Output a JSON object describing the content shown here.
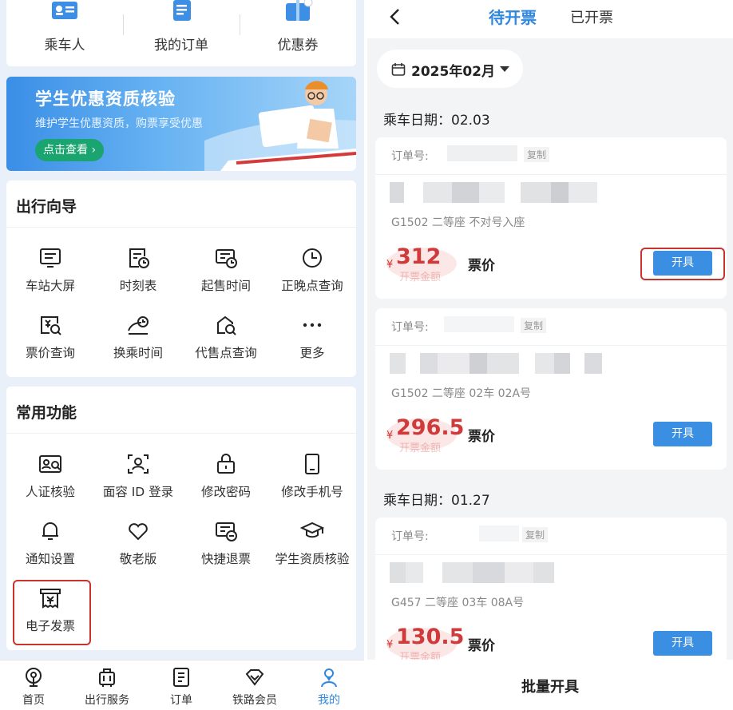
{
  "left": {
    "top_row": [
      "乘车人",
      "我的订单",
      "优惠券"
    ],
    "banner": {
      "title": "学生优惠资质核验",
      "subtitle": "维护学生优惠资质，购票享受优惠",
      "button": "点击查看 ›"
    },
    "travel_guide": {
      "title": "出行向导",
      "items": [
        "车站大屏",
        "时刻表",
        "起售时间",
        "正晚点查询",
        "票价查询",
        "换乘时间",
        "代售点查询",
        "更多"
      ]
    },
    "common": {
      "title": "常用功能",
      "items": [
        "人证核验",
        "面容 ID 登录",
        "修改密码",
        "修改手机号",
        "通知设置",
        "敬老版",
        "快捷退票",
        "学生资质核验",
        "电子发票"
      ]
    },
    "tabbar": [
      "首页",
      "出行服务",
      "订单",
      "铁路会员",
      "我的"
    ],
    "active_tab": "我的"
  },
  "right": {
    "tabs": {
      "active": "待开票",
      "other": "已开票"
    },
    "month": "2025年02月",
    "groups": [
      {
        "date_label": "乘车日期：02.03",
        "orders": [
          {
            "order_label": "订单号:",
            "copy": "复制",
            "train": "G1502 二等座  不对号入座",
            "currency": "¥",
            "price": "312",
            "watermark": "开票金额",
            "price_label": "票价",
            "button": "开具"
          },
          {
            "order_label": "订单号:",
            "copy": "复制",
            "train": "G1502 二等座 02车 02A号",
            "currency": "¥",
            "price": "296.5",
            "watermark": "开票金额",
            "price_label": "票价",
            "button": "开具"
          }
        ]
      },
      {
        "date_label": "乘车日期：01.27",
        "orders": [
          {
            "order_label": "订单号:",
            "copy": "复制",
            "train": "G457 二等座 03车 08A号",
            "currency": "¥",
            "price": "130.5",
            "watermark": "开票金额",
            "price_label": "票价",
            "button": "开具"
          }
        ]
      }
    ],
    "batch": "批量开具"
  },
  "colors": {
    "accent": "#2f87e0",
    "price": "#cf3b3b",
    "highlight": "#c8332d",
    "green": "#1aa46f"
  }
}
